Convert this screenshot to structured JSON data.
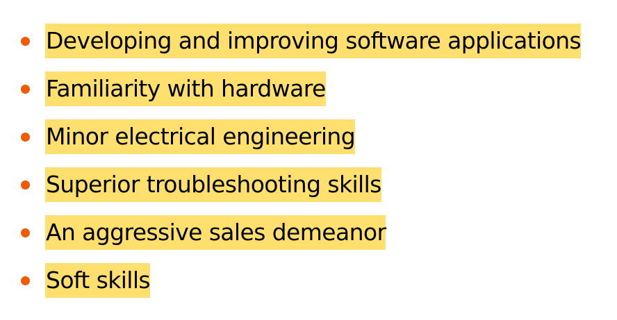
{
  "colors": {
    "bullet": "#f05a00",
    "highlight": "#ffdf6e",
    "text": "#000000",
    "background": "#ffffff"
  },
  "bullet_icon": "filled-circle",
  "list": {
    "items": [
      {
        "text": "Developing and improving software applications"
      },
      {
        "text": "Familiarity with hardware"
      },
      {
        "text": "Minor electrical engineering"
      },
      {
        "text": "Superior troubleshooting skills"
      },
      {
        "text": "An aggressive sales demeanor"
      },
      {
        "text": "Soft skills"
      }
    ]
  }
}
